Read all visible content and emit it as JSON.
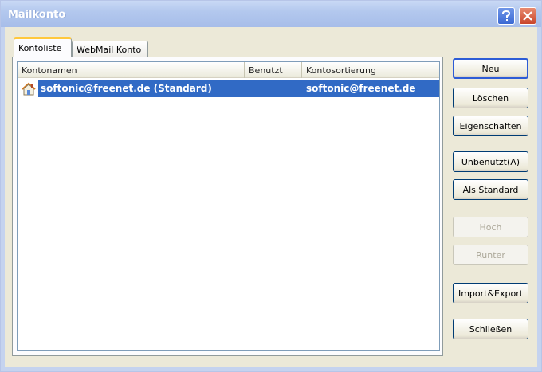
{
  "window": {
    "title": "Mailkonto"
  },
  "tabs": [
    {
      "label": "Kontoliste",
      "active": true
    },
    {
      "label": "WebMail Konto",
      "active": false
    }
  ],
  "list": {
    "columns": [
      "Kontonamen",
      "Benutzt",
      "Kontosortierung"
    ],
    "rows": [
      {
        "icon": "home-icon",
        "name": "softonic@freenet.de (Standard)",
        "used": "",
        "sort": "softonic@freenet.de",
        "selected": true
      }
    ]
  },
  "buttons": {
    "neu": "Neu",
    "loeschen": "Löschen",
    "eigenschaften": "Eigenschaften",
    "unbenutzt": "Unbenutzt(A)",
    "als_standard": "Als Standard",
    "hoch": "Hoch",
    "runter": "Runter",
    "import_export": "Import&Export",
    "schliessen": "Schließen"
  },
  "colors": {
    "selection": "#316ac5",
    "titlebar": "#b3c8ee",
    "dialog": "#ece9d8"
  }
}
